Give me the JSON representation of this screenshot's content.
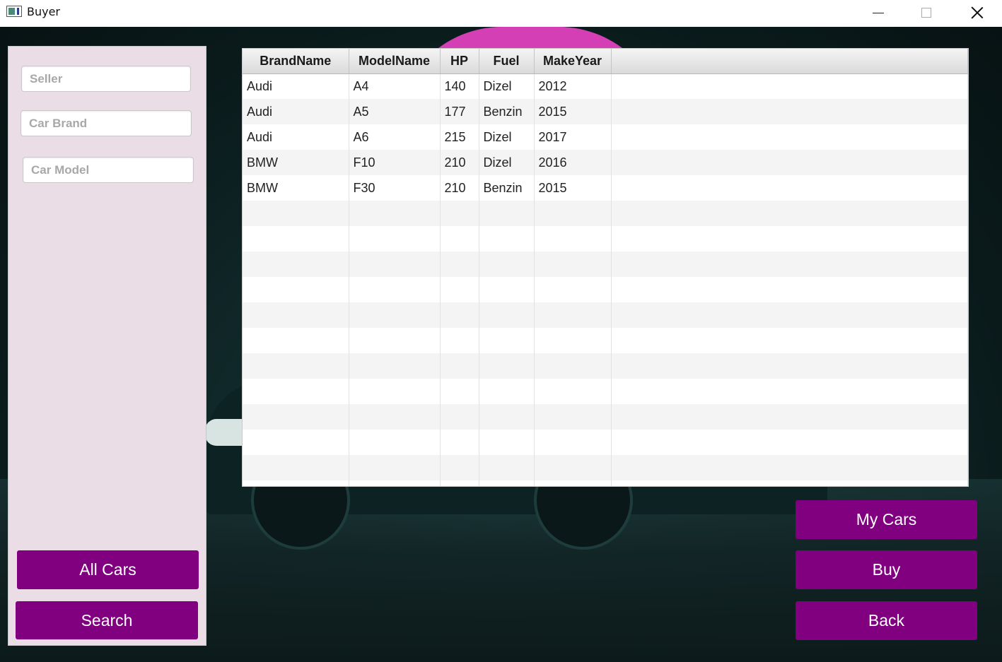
{
  "window": {
    "title": "Buyer"
  },
  "filters": {
    "seller_placeholder": "Seller",
    "brand_placeholder": "Car Brand",
    "model_placeholder": "Car Model"
  },
  "left_buttons": {
    "all_cars": "All Cars",
    "search": "Search"
  },
  "right_buttons": {
    "my_cars": "My Cars",
    "buy": "Buy",
    "back": "Back"
  },
  "table": {
    "columns": [
      "BrandName",
      "ModelName",
      "HP",
      "Fuel",
      "MakeYear"
    ],
    "rows": [
      [
        "Audi",
        "A4",
        "140",
        "Dizel",
        "2012"
      ],
      [
        "Audi",
        "A5",
        "177",
        "Benzin",
        "2015"
      ],
      [
        "Audi",
        "A6",
        "215",
        "Dizel",
        "2017"
      ],
      [
        "BMW",
        "F10",
        "210",
        "Dizel",
        "2016"
      ],
      [
        "BMW",
        "F30",
        "210",
        "Benzin",
        "2015"
      ]
    ]
  },
  "colors": {
    "accent_purple": "#800080",
    "panel_bg": "#ebdde5",
    "sun_pink": "#d43fb6"
  }
}
